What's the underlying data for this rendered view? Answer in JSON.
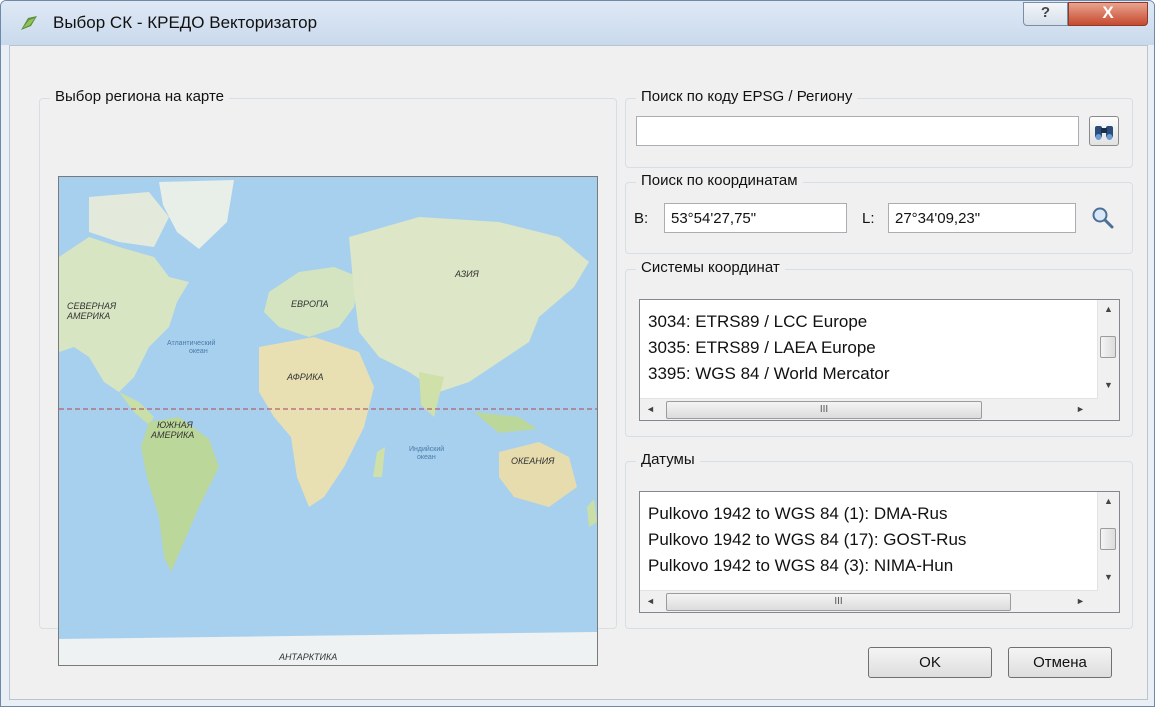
{
  "window": {
    "title": "Выбор СК - КРЕДО Векторизатор",
    "help_label": "?",
    "close_label": "X"
  },
  "map_group": {
    "title": "Выбор региона на карте",
    "labels": {
      "north_america": "СЕВЕРНАЯ АМЕРИКА",
      "europe": "ЕВРОПА",
      "asia": "АЗИЯ",
      "atlantic": "Атлантический океан",
      "africa": "АФРИКА",
      "south_america": "ЮЖНАЯ АМЕРИКА",
      "indian": "Индийский океан",
      "oceania": "ОКЕАНИЯ",
      "antarctica": "АНТАРКТИКА"
    }
  },
  "epsg_search": {
    "title": "Поиск по коду EPSG / Региону",
    "value": "",
    "search_icon": "binoculars-icon"
  },
  "coord_search": {
    "title": "Поиск по координатам",
    "b_label": "B:",
    "b_value": "53°54'27,75\"",
    "l_label": "L:",
    "l_value": "27°34'09,23\"",
    "search_icon": "magnifier-icon"
  },
  "coordinate_systems": {
    "title": "Системы координат",
    "items": [
      "3034: ETRS89 / LCC Europe",
      "3035: ETRS89 / LAEA Europe",
      "3395: WGS 84 / World Mercator"
    ]
  },
  "datums": {
    "title": "Датумы",
    "items": [
      "Pulkovo 1942 to WGS 84 (1): DMA-Rus",
      "Pulkovo 1942 to WGS 84 (17): GOST-Rus",
      "Pulkovo 1942 to WGS 84 (3): NIMA-Hun"
    ]
  },
  "scroll": {
    "up": "▲",
    "down": "▼",
    "left": "◄",
    "right": "►",
    "grip": "III"
  },
  "buttons": {
    "ok": "OK",
    "cancel": "Отмена"
  }
}
